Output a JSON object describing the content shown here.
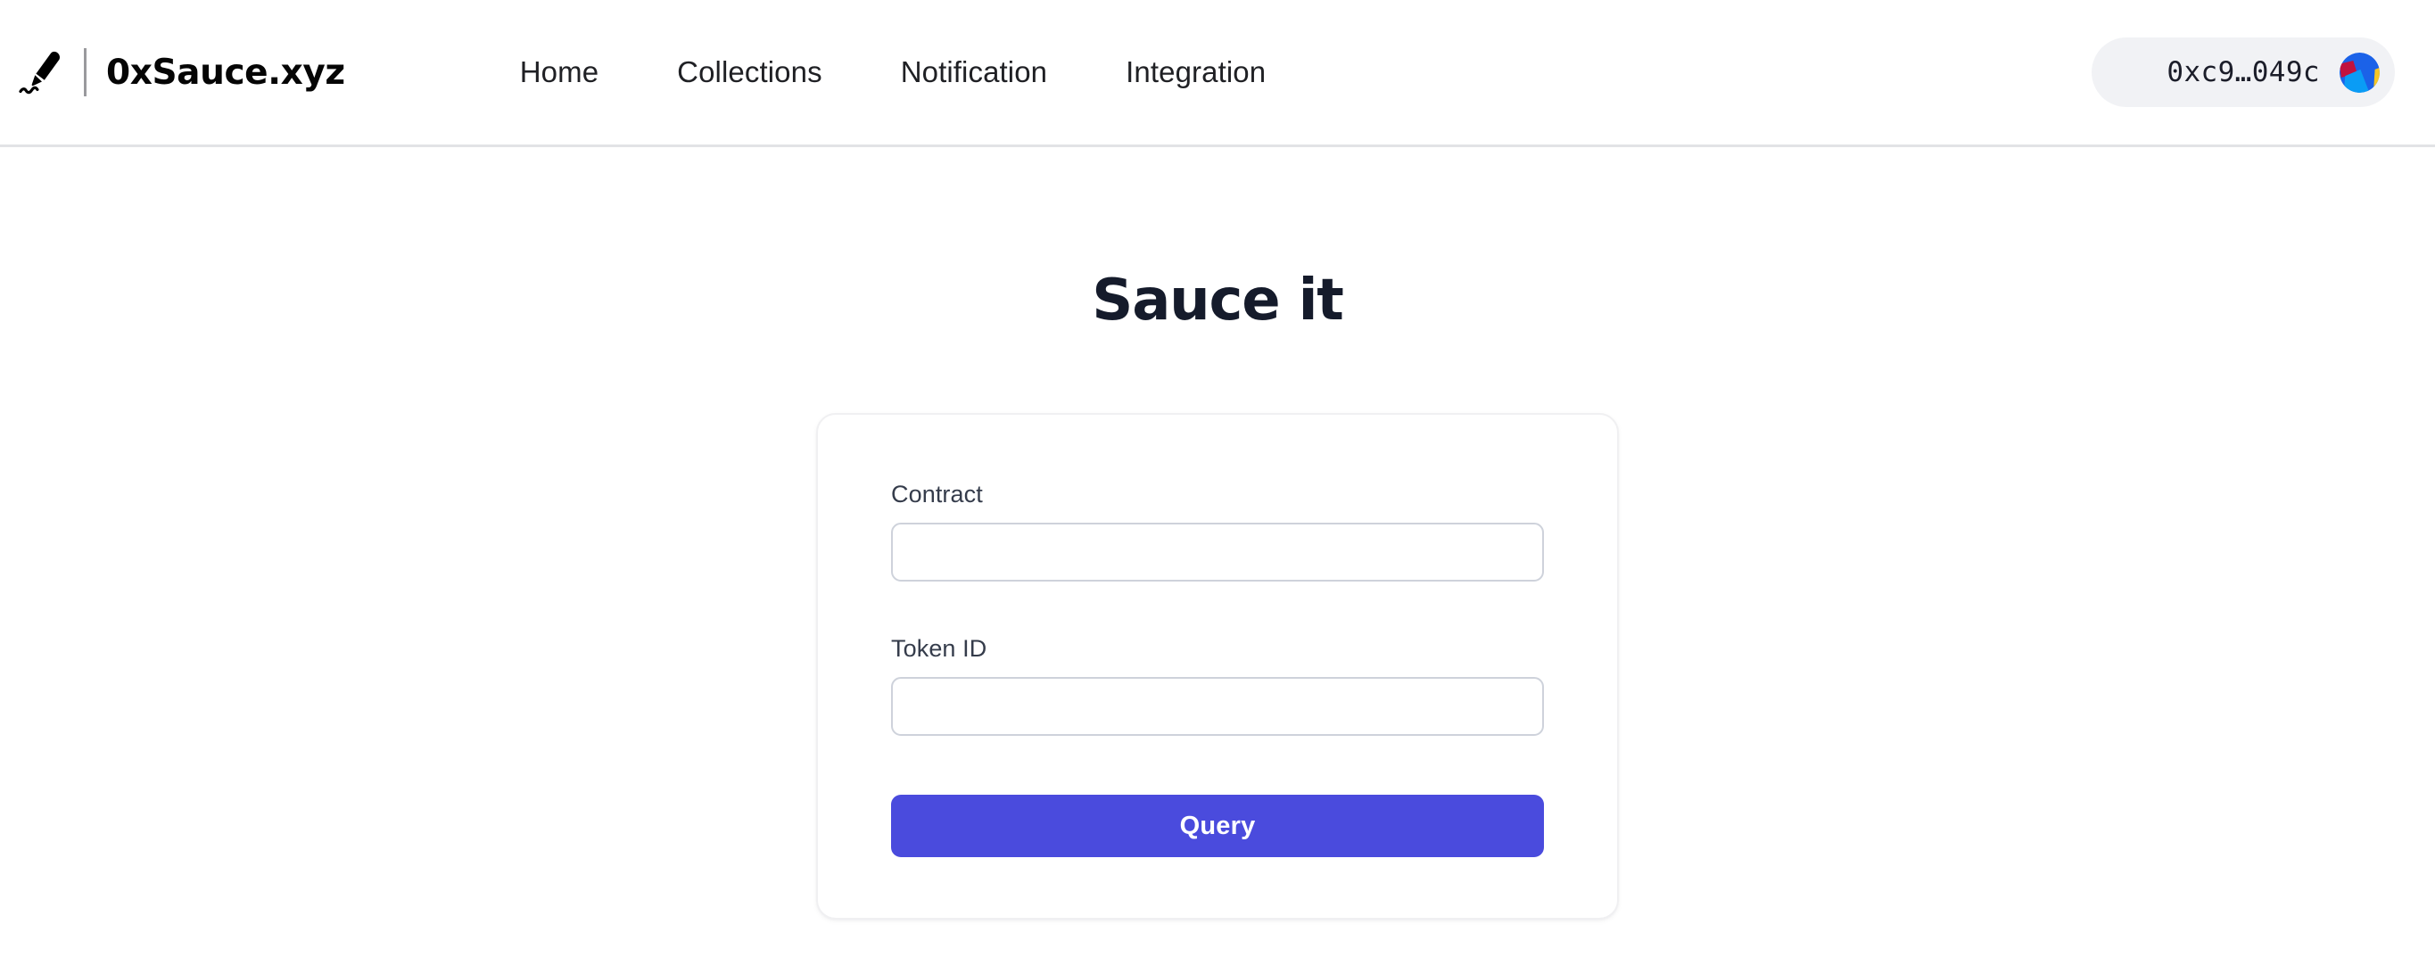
{
  "header": {
    "brand": {
      "name": "0xSauce.xyz",
      "logo_icon": "pen-squiggle-icon"
    },
    "nav": [
      {
        "label": "Home"
      },
      {
        "label": "Collections"
      },
      {
        "label": "Notification"
      },
      {
        "label": "Integration"
      }
    ],
    "wallet": {
      "address": "0xc9…049c",
      "avatar_icon": "wallet-jazzicon",
      "pill_background": "#f1f2f5",
      "avatar_colors": {
        "base": "#1b62e8",
        "crimson": "#c1123f",
        "light_blue": "#0a9cf5",
        "yellow": "#f7c623"
      }
    }
  },
  "main": {
    "title": "Sauce it",
    "form": {
      "fields": [
        {
          "label": "Contract",
          "value": "",
          "placeholder": ""
        },
        {
          "label": "Token ID",
          "value": "",
          "placeholder": ""
        }
      ],
      "submit_label": "Query",
      "accent_color": "#4a4bdd"
    }
  }
}
